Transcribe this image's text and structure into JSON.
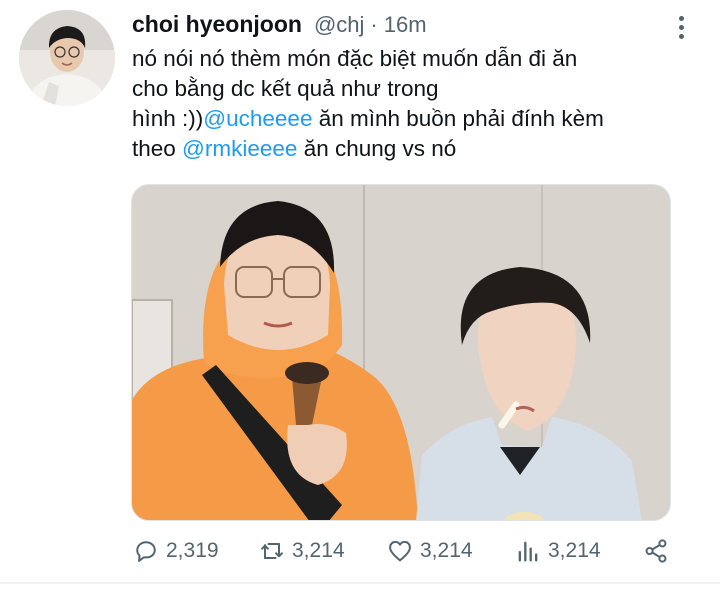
{
  "tweet": {
    "author": {
      "display_name": "choi hyeonjoon",
      "handle": "@chj",
      "separator": "·",
      "time": "16m"
    },
    "text_lines": [
      [
        {
          "text": "nó nói nó thèm món đặc biệt muốn dẫn đi ăn",
          "type": "text"
        }
      ],
      [
        {
          "text": "cho bằng dc kết quả như trong",
          "type": "text"
        }
      ],
      [
        {
          "text": "hình :))",
          "type": "text"
        },
        {
          "text": "@ucheeee",
          "type": "mention"
        },
        {
          "text": " ăn mình buồn phải đính kèm",
          "type": "text"
        }
      ],
      [
        {
          "text": "theo ",
          "type": "text"
        },
        {
          "text": "@rmkieeee",
          "type": "mention"
        },
        {
          "text": " ăn chung vs nó",
          "type": "text"
        }
      ]
    ],
    "actions": {
      "reply_count": "2,319",
      "retweet_count": "3,214",
      "like_count": "3,214",
      "views_count": "3,214"
    }
  },
  "colors": {
    "accent": "#1d9bf0",
    "secondary_text": "#536471",
    "primary_text": "#0f1419"
  },
  "icons": [
    "more-vertical-icon",
    "reply-icon",
    "retweet-icon",
    "like-icon",
    "views-icon",
    "share-icon"
  ]
}
